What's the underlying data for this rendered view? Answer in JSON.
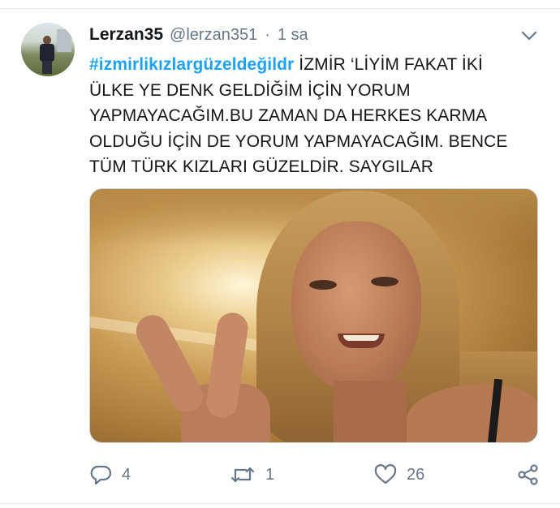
{
  "tweet": {
    "display_name": "Lerzan35",
    "handle": "@lerzan351",
    "separator": "·",
    "time": "1 sa",
    "hashtag": "#izmirlikızlargüzeldeğildr",
    "text_lines": [
      " İZMİR ‘LİYİM FAKAT İKİ",
      "ÜLKE YE DENK GELDİĞİM İÇİN YORUM",
      "YAPMAYACAĞIM.BU ZAMAN DA HERKES KARMA",
      "OLDUĞU İÇİN DE YORUM YAPMAYACAĞIM. BENCE",
      "TÜM TÜRK KIZLARI GÜZELDİR. SAYGILAR"
    ]
  },
  "actions": {
    "reply_count": "4",
    "retweet_count": "1",
    "like_count": "26"
  },
  "icons": {
    "menu": "chevron-down-icon",
    "reply": "reply-icon",
    "retweet": "retweet-icon",
    "like": "heart-icon",
    "share": "share-icon"
  },
  "colors": {
    "hashtag": "#1da1f2",
    "text": "#14171a",
    "secondary": "#657786"
  }
}
